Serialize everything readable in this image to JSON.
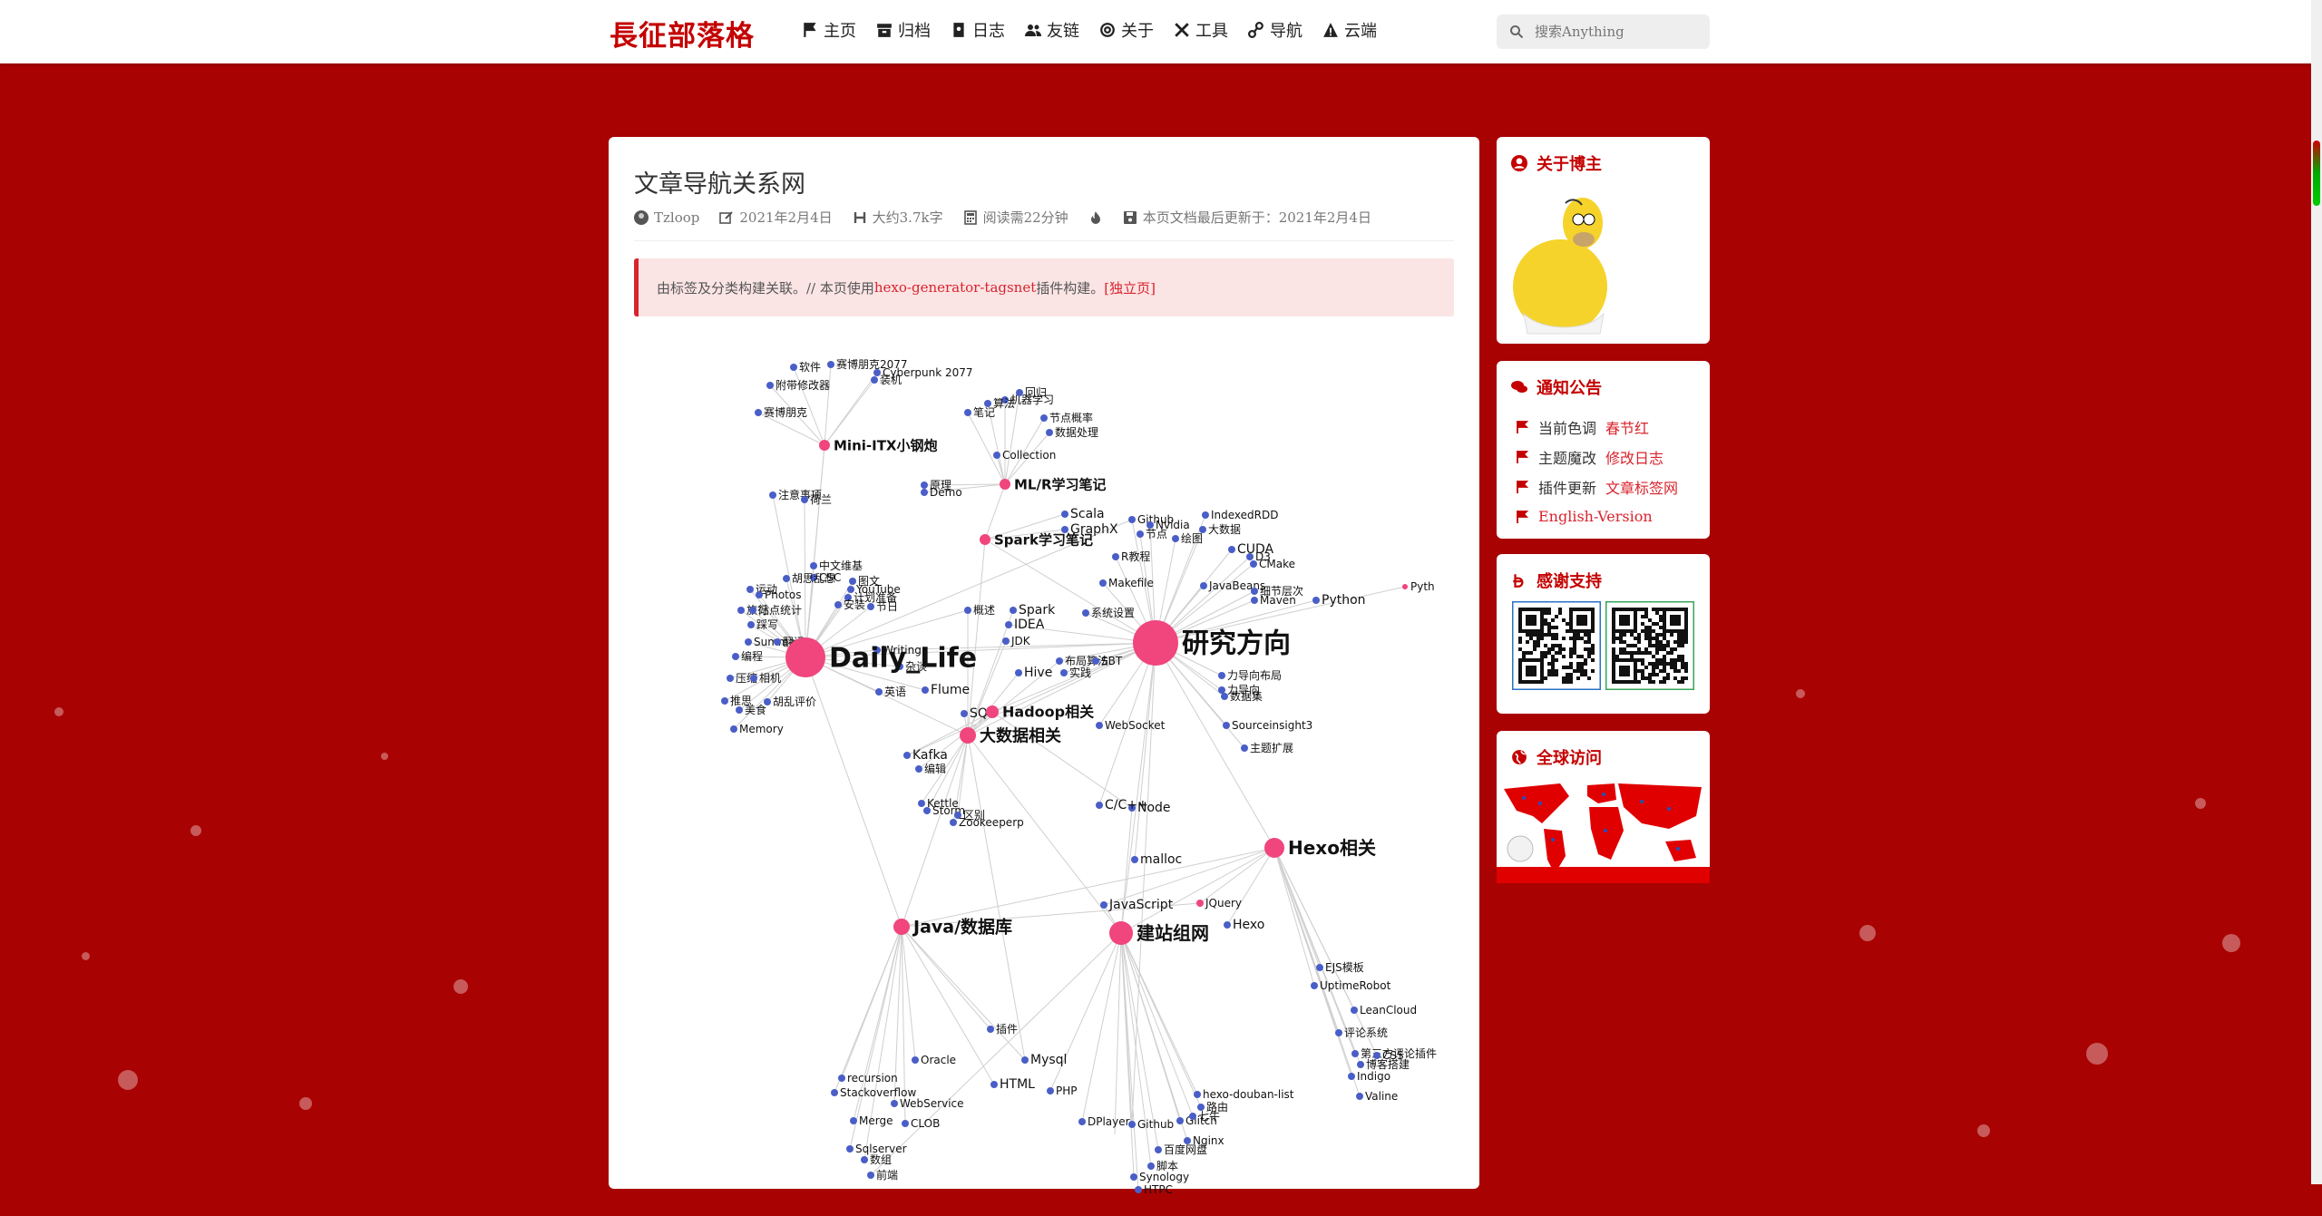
{
  "site": {
    "brand": "長征部落格"
  },
  "nav": [
    {
      "icon": "flag-icon",
      "label": "主页"
    },
    {
      "icon": "archive-icon",
      "label": "归档"
    },
    {
      "icon": "book-icon",
      "label": "日志"
    },
    {
      "icon": "users-icon",
      "label": "友链"
    },
    {
      "icon": "at-icon",
      "label": "关于"
    },
    {
      "icon": "tools-icon",
      "label": "工具"
    },
    {
      "icon": "sitemap-icon",
      "label": "导航"
    },
    {
      "icon": "warning-icon",
      "label": "云端"
    }
  ],
  "search": {
    "placeholder": "搜索Anything"
  },
  "post": {
    "title": "文章导航关系网",
    "author": "Tzloop",
    "date": "2021年2月4日",
    "words": "大约3.7k字",
    "read_time": "阅读需22分钟",
    "updated": "本页文档最后更新于：2021年2月4日",
    "notice_prefix": "由标签及分类构建关联。// 本页使用",
    "notice_link": "hexo-generator-tagsnet",
    "notice_mid": "插件构建。",
    "notice_standalone": "[独立页]"
  },
  "sidebar": {
    "about_title": "关于博主",
    "announce_title": "通知公告",
    "announcements": [
      {
        "text": "当前色调",
        "link": "春节红"
      },
      {
        "text": "主题魔改",
        "link": "修改日志"
      },
      {
        "text": "插件更新",
        "link": "文章标签网"
      },
      {
        "text": "",
        "link": "English-Version"
      }
    ],
    "thanks_title": "感谢支持",
    "visits_title": "全球访问"
  },
  "colors": {
    "theme_red": "#a90202",
    "accent": "#c40000",
    "hub_pink": "#f0457d",
    "leaf_blue": "#4a5ec8"
  },
  "graph": {
    "hubs": [
      {
        "label": "Daily_Life",
        "big": true
      },
      {
        "label": "研究方向",
        "big": true
      },
      {
        "label": "Mini-ITX小钢炮"
      },
      {
        "label": "ML/R学习笔记"
      },
      {
        "label": "Spark学习笔记"
      },
      {
        "label": "Hadoop相关"
      },
      {
        "label": "大数据相关"
      },
      {
        "label": "Hexo相关"
      },
      {
        "label": "Java/数据库"
      },
      {
        "label": "建站组网"
      }
    ],
    "leaves": [
      "软件",
      "赛博朋克2077",
      "Cyberpunk 2077",
      "装机",
      "附带修改器",
      "赛博朋克",
      "注意事项",
      "荷兰",
      "中文维基",
      "CSC",
      "胡思乱想",
      "图文",
      "运动",
      "YouTube",
      "Photos",
      "计划准备",
      "安装",
      "节日",
      "旅行",
      "站点统计",
      "踩写",
      "Summary",
      "翻译",
      "编程",
      "压缩",
      "相机",
      "推思",
      "胡乱评价",
      "美食",
      "Memory",
      "Writing",
      "杂谈",
      "英语",
      "Flume",
      "机器学习",
      "回归",
      "算法",
      "笔记",
      "节点概率",
      "数据处理",
      "Collection",
      "原理",
      "Demo",
      "Scala",
      "GraphX",
      "Github",
      "Nvidia",
      "IndexedRDD",
      "大数据",
      "节点",
      "绘图",
      "CUDA",
      "Makefile",
      "R教程",
      "D3",
      "CMake",
      "JavaBeans",
      "细节层次",
      "Maven",
      "概述",
      "IDEA",
      "Spark",
      "JDK",
      "系统设置",
      "Python",
      "Pyth",
      "布局算法",
      "SBT",
      "实践",
      "Hive",
      "力导向布局",
      "力导向",
      "数据集",
      "Sourceinsight3",
      "主题扩展",
      "WebSocket",
      "Kafka",
      "编辑",
      "Kettle",
      "Storm",
      "区别",
      "Zookeeperp",
      "SQL",
      "Node",
      "C/C++",
      "malloc",
      "JavaScript",
      "JQuery",
      "Hexo",
      "EJS模板",
      "UptimeRobot",
      "LeanCloud",
      "评论系统",
      "第三方评论插件",
      "CSS",
      "博客搭建",
      "Indigo",
      "Valine",
      "插件",
      "Mysql",
      "HTML",
      "Oracle",
      "recursion",
      "Stackoverflow",
      "WebService",
      "Merge",
      "CLOB",
      "Sqlserver",
      "数组",
      "前端",
      "PHP",
      "DPlayer",
      "Github",
      "Glitch",
      "Nginx",
      "Synology",
      "HTPC",
      "脚本",
      "百度网盘",
      "hexo-douban-list",
      "路由",
      "七牛"
    ]
  }
}
